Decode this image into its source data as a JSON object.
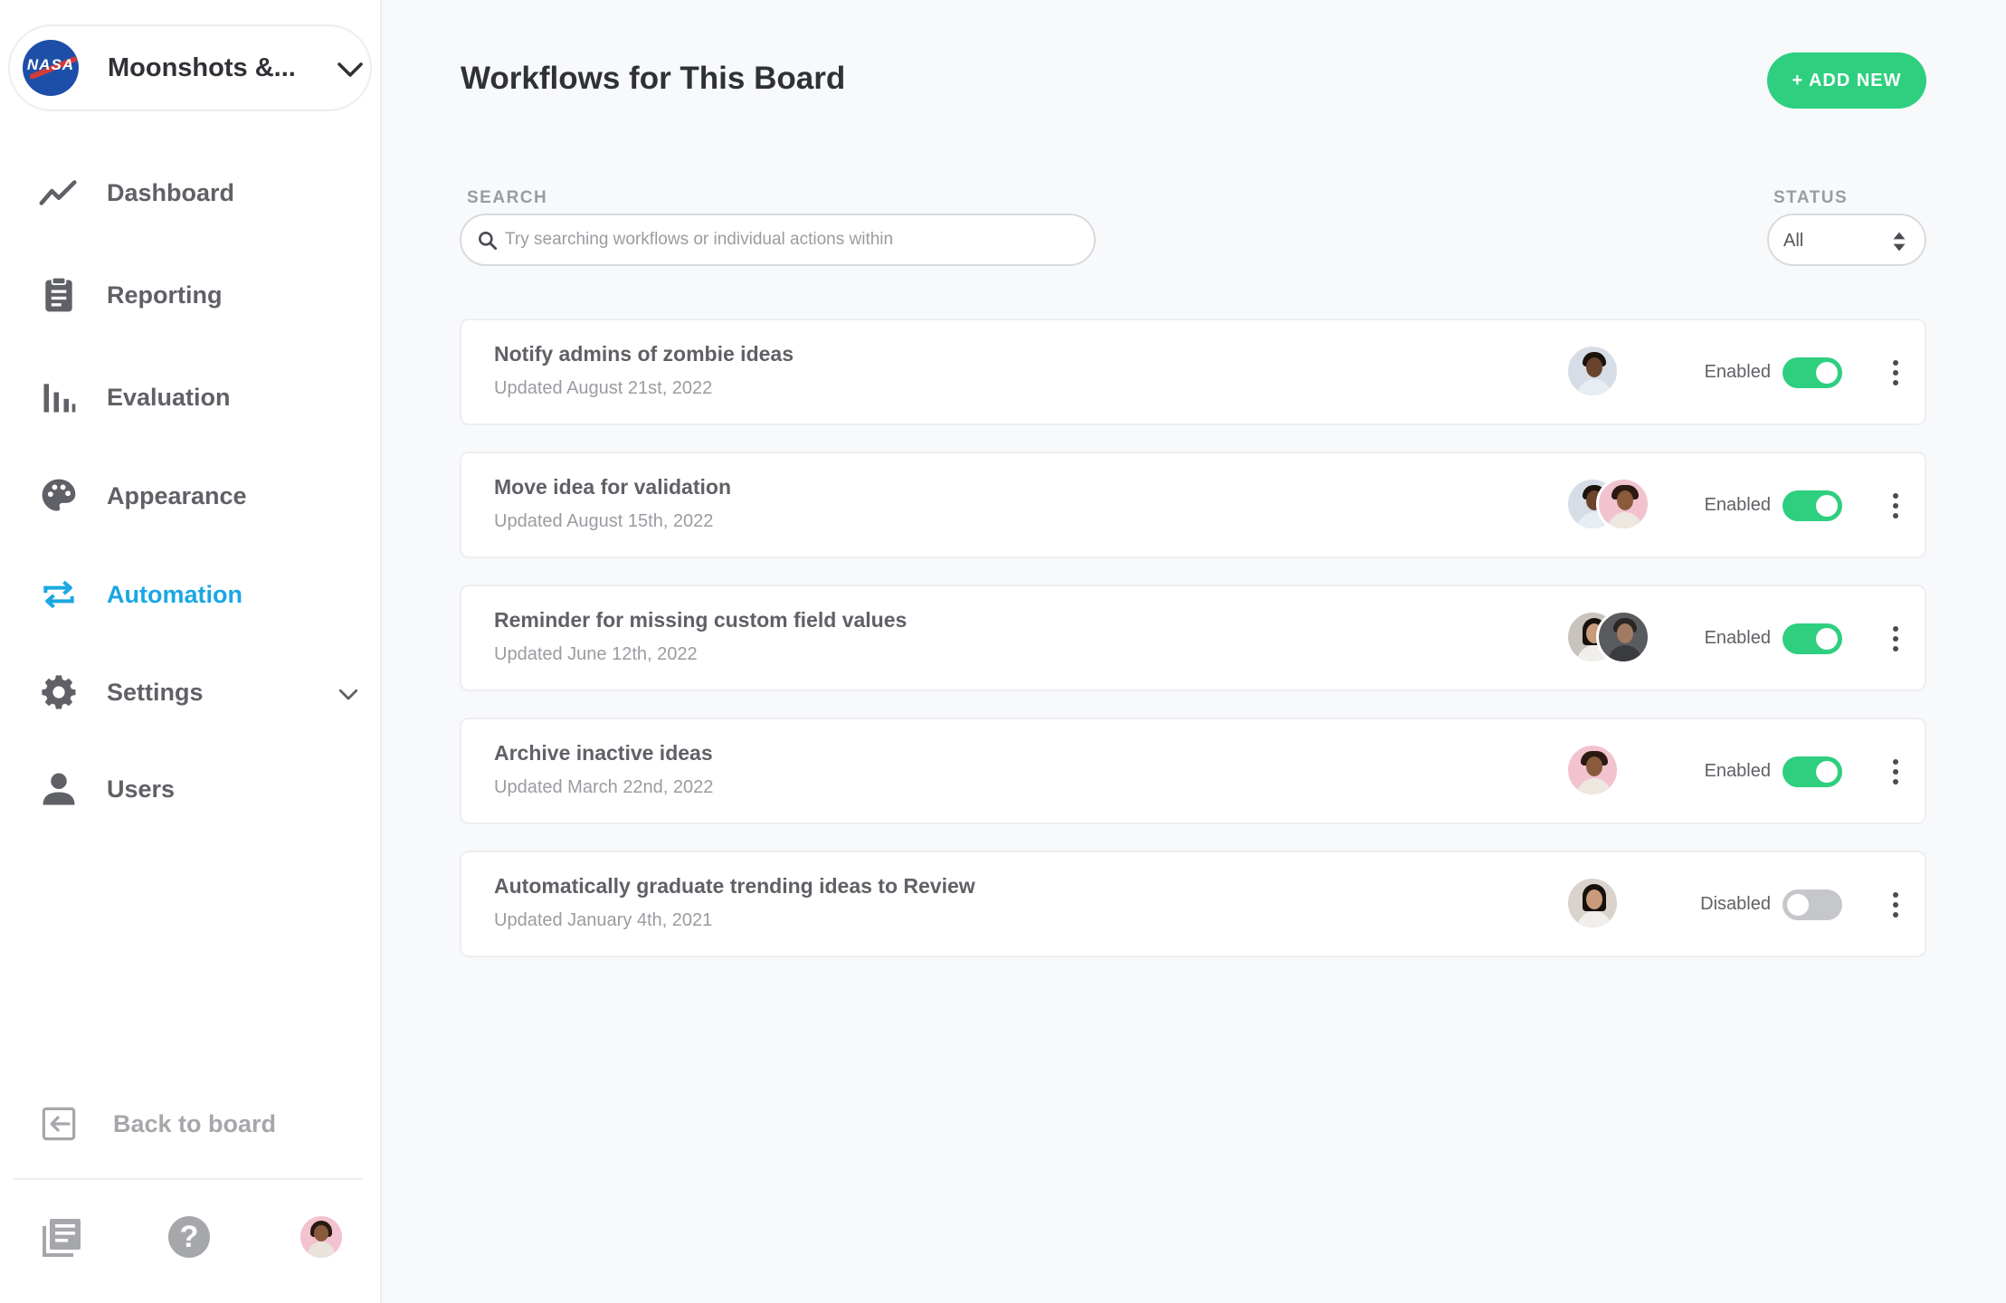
{
  "org": {
    "name": "Moonshots &...",
    "logo_text": "NASA"
  },
  "nav": {
    "dashboard": "Dashboard",
    "reporting": "Reporting",
    "evaluation": "Evaluation",
    "appearance": "Appearance",
    "automation": "Automation",
    "settings": "Settings",
    "users": "Users"
  },
  "footer": {
    "back_label": "Back to board",
    "help_glyph": "?"
  },
  "page": {
    "title": "Workflows for This Board",
    "add_button": "+ ADD NEW"
  },
  "search": {
    "label": "SEARCH",
    "placeholder": "Try searching workflows or individual actions within",
    "value": ""
  },
  "status_filter": {
    "label": "STATUS",
    "value": "All"
  },
  "workflows": [
    {
      "title": "Notify admins of zombie ideas",
      "updated": "Updated August 21st, 2022",
      "status": "Enabled",
      "enabled": true
    },
    {
      "title": "Move idea for validation",
      "updated": "Updated August 15th, 2022",
      "status": "Enabled",
      "enabled": true
    },
    {
      "title": "Reminder for missing custom field values",
      "updated": "Updated June 12th, 2022",
      "status": "Enabled",
      "enabled": true
    },
    {
      "title": "Archive inactive ideas",
      "updated": "Updated March 22nd, 2022",
      "status": "Enabled",
      "enabled": true
    },
    {
      "title": "Automatically graduate trending ideas to Review",
      "updated": "Updated January 4th, 2021",
      "status": "Disabled",
      "enabled": false
    }
  ],
  "colors": {
    "accent": "#1aa7e3",
    "success": "#2ecf7f",
    "toggle_off": "#c5c7cb",
    "muted": "#9a9ca1"
  },
  "icons": [
    "chevron-down-icon",
    "trend-line-icon",
    "clipboard-icon",
    "bar-chart-icon",
    "palette-icon",
    "repeat-icon",
    "gear-icon",
    "user-icon",
    "exit-icon",
    "news-icon",
    "help-icon",
    "search-icon",
    "sort-arrows-icon",
    "kebab-icon"
  ]
}
